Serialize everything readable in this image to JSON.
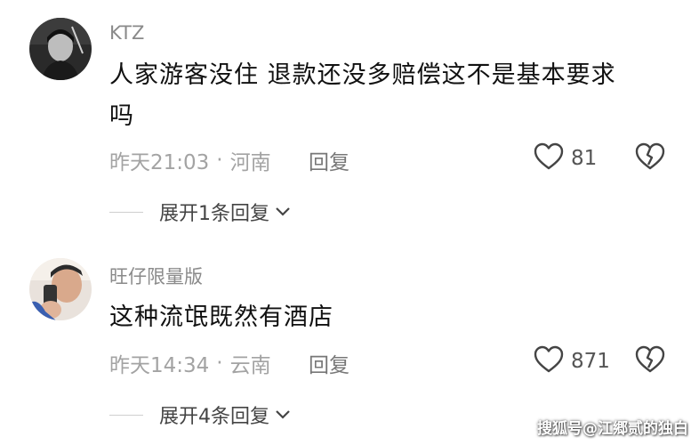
{
  "comments": [
    {
      "username": "KTZ",
      "text_line1": "人家游客没住 退款还没多赔偿这不是基本要求",
      "text_line2": "吗",
      "time": "昨天21:03",
      "separator": "·",
      "location": "河南",
      "reply_label": "回复",
      "like_count": "81",
      "expand_label": "展开1条回复"
    },
    {
      "username": "旺仔限量版",
      "text_line1": "这种流氓既然有酒店",
      "time": "昨天14:34",
      "separator": "·",
      "location": "云南",
      "reply_label": "回复",
      "like_count": "871",
      "expand_label": "展开4条回复"
    }
  ],
  "watermark": "搜狐号@江郷贰的独白",
  "icons": {
    "like": "heart-outline-icon",
    "dislike": "broken-heart-icon",
    "expand": "chevron-down-icon"
  },
  "colors": {
    "username": "#8a8a8a",
    "meta": "#a3a3a3",
    "text": "#111111"
  }
}
